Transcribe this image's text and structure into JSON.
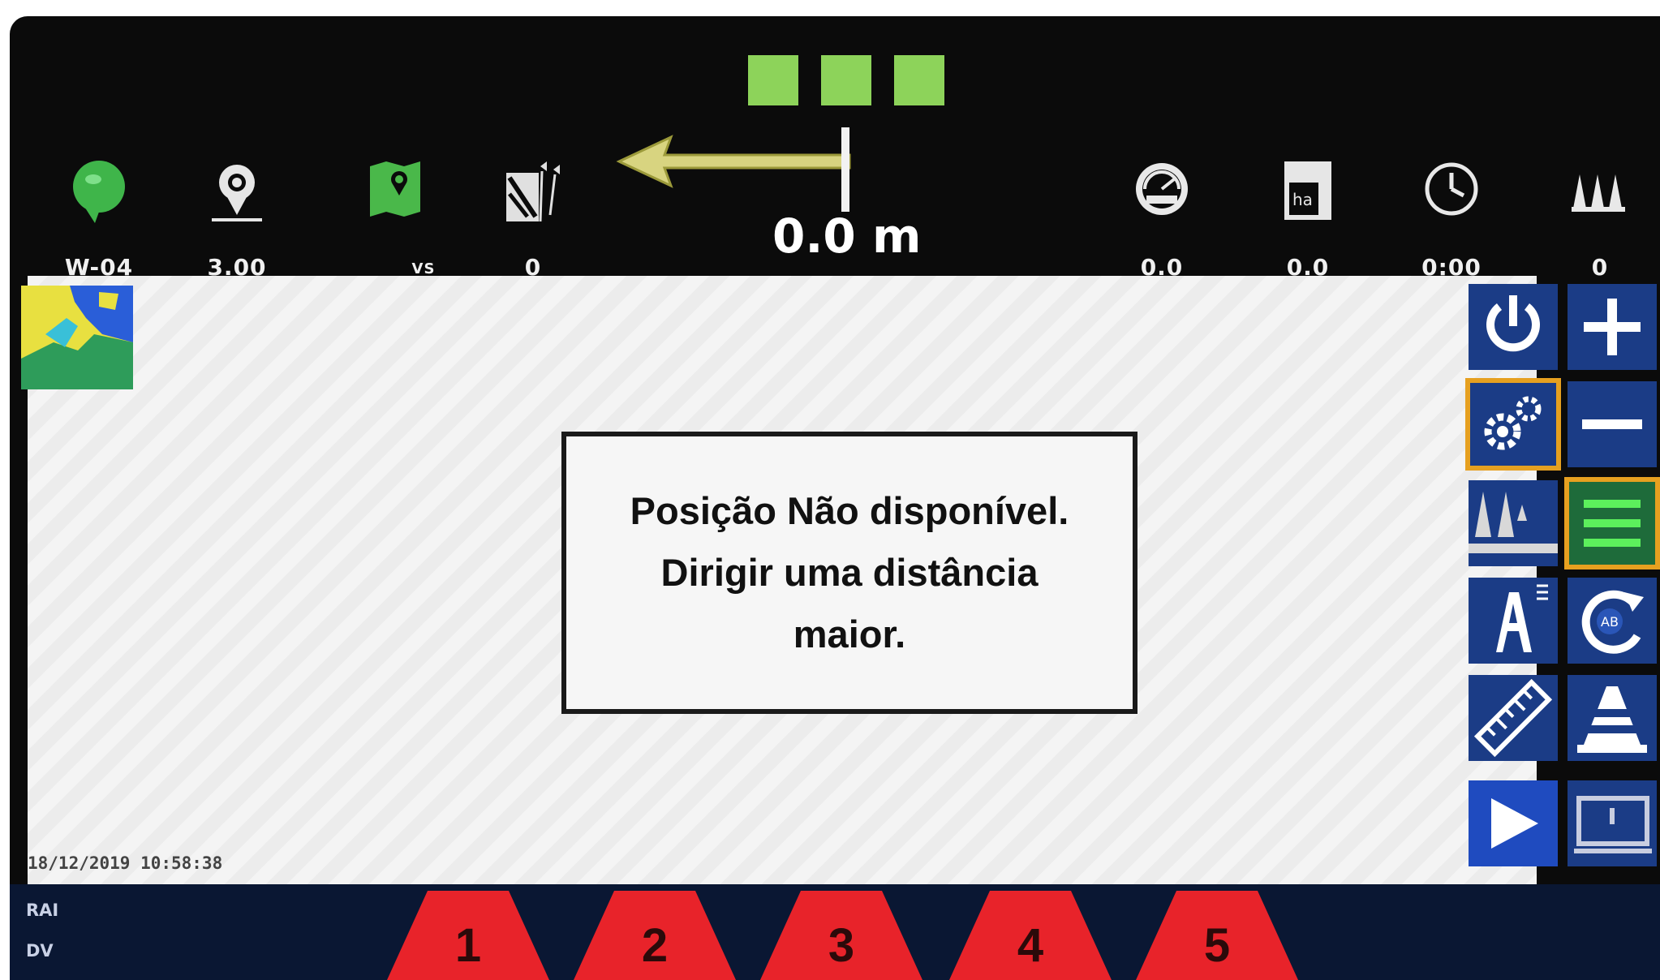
{
  "topbar": {
    "items": [
      {
        "icon": "field-pin-icon",
        "value": "W-04"
      },
      {
        "icon": "implement-width-icon",
        "value": "3.00"
      },
      {
        "icon": "map-icon",
        "value": "VS"
      },
      {
        "icon": "guidance-pattern-icon",
        "value": "0"
      }
    ],
    "gps_status": [
      "green",
      "green",
      "green"
    ],
    "cross_track_error": "0.0 m",
    "right_items": [
      {
        "icon": "speedometer-icon",
        "value": "0.0"
      },
      {
        "icon": "area-ha-icon",
        "value": "0.0"
      },
      {
        "icon": "clock-icon",
        "value": "0:00"
      },
      {
        "icon": "sections-icon",
        "value": "0"
      }
    ]
  },
  "message": {
    "line1": "Posição Não disponível.",
    "line2": "Dirigir uma distância",
    "line3": "maior."
  },
  "map": {
    "timestamp": "18/12/2019 10:58:38"
  },
  "right_buttons": [
    {
      "name": "power-button",
      "icon": "power-icon"
    },
    {
      "name": "zoom-in-button",
      "icon": "plus-icon"
    },
    {
      "name": "settings-button",
      "icon": "gears-icon",
      "active": true
    },
    {
      "name": "zoom-out-button",
      "icon": "minus-icon"
    },
    {
      "name": "boom-view-button",
      "icon": "boom-icon"
    },
    {
      "name": "guidance-lines-button",
      "icon": "lines-icon",
      "active": true
    },
    {
      "name": "auto-section-button",
      "icon": "auto-a-icon"
    },
    {
      "name": "ab-line-button",
      "icon": "ab-rotate-icon"
    },
    {
      "name": "ruler-button",
      "icon": "ruler-icon"
    },
    {
      "name": "cone-button",
      "icon": "cone-icon"
    },
    {
      "name": "play-button",
      "icon": "play-icon"
    },
    {
      "name": "display-button",
      "icon": "screen-icon"
    }
  ],
  "bottombar": {
    "mode_label_1": "RAI",
    "mode_label_2": "DV",
    "sections": [
      "1",
      "2",
      "3",
      "4",
      "5"
    ],
    "section_color": "#e8232a"
  },
  "colors": {
    "accent_orange": "#e6a020",
    "button_blue": "#1b3c86",
    "gps_green": "#8dd35a"
  }
}
